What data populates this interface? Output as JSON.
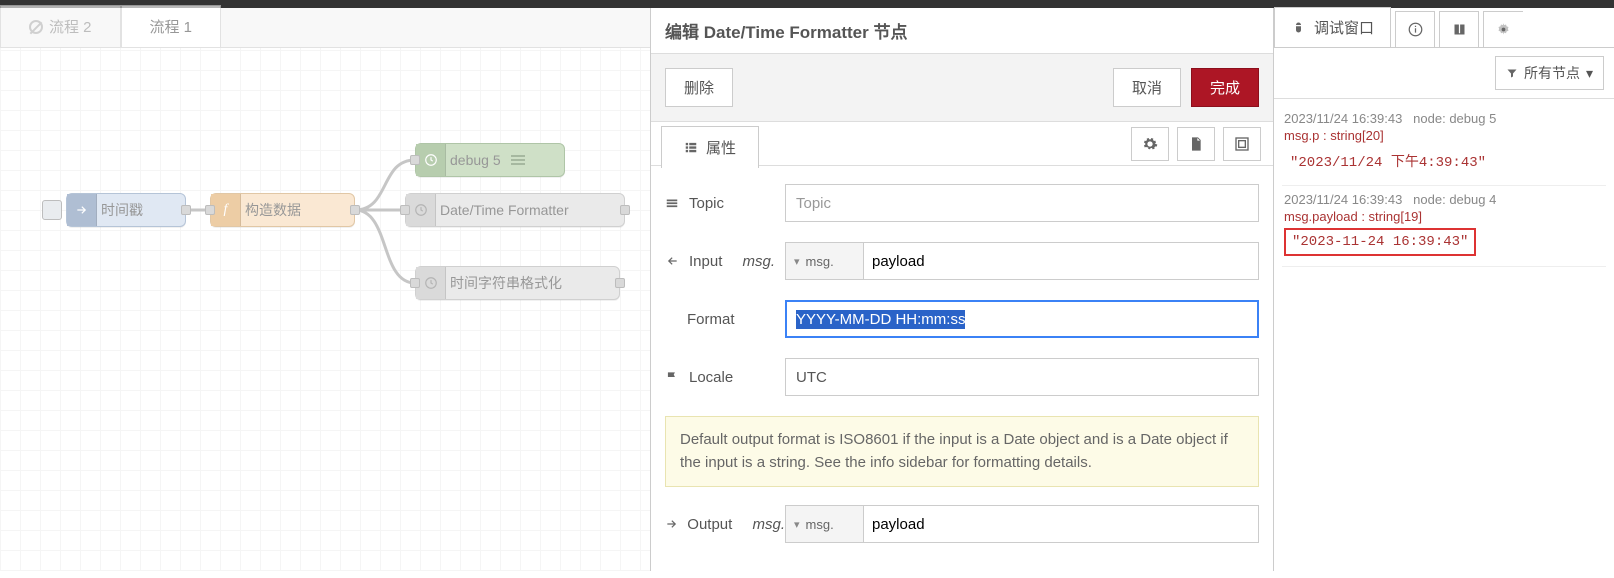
{
  "tabs": [
    {
      "label": "流程 2",
      "active": false,
      "disabled": true
    },
    {
      "label": "流程 1",
      "active": true,
      "disabled": false
    }
  ],
  "nodes": {
    "inject": {
      "label": "时间戳"
    },
    "function": {
      "label": "构造数据"
    },
    "debug": {
      "label": "debug 5"
    },
    "formatter": {
      "label": "Date/Time Formatter"
    },
    "format2": {
      "label": "时间字符串格式化"
    }
  },
  "editor": {
    "title": "编辑 Date/Time Formatter 节点",
    "delete": "删除",
    "cancel": "取消",
    "done": "完成",
    "propsTab": "属性",
    "labels": {
      "topic": "Topic",
      "input": "Input",
      "inputItalic": "msg.",
      "format": "Format",
      "locale": "Locale",
      "output": "Output",
      "outputItalic": "msg."
    },
    "placeholders": {
      "topic": "Topic"
    },
    "values": {
      "msgPrefix": "msg.",
      "inputPayload": "payload",
      "format": "YYYY-MM-DD HH:mm:ss",
      "locale": "UTC",
      "outputPayload": "payload"
    },
    "hint": "Default output format is ISO8601 if the input is a Date object and is a Date object if the input is a string. See the info sidebar for formatting details."
  },
  "sidebar": {
    "tab": "调试窗口",
    "filter": "所有节点",
    "messages": [
      {
        "ts": "2023/11/24 16:39:43",
        "src": "node: debug 5",
        "type": "msg.p : string[20]",
        "value": "\"2023/11/24 下午4:39:43\"",
        "boxed": false
      },
      {
        "ts": "2023/11/24 16:39:43",
        "src": "node: debug 4",
        "type": "msg.payload : string[19]",
        "value": "\"2023-11-24 16:39:43\"",
        "boxed": true
      }
    ]
  }
}
